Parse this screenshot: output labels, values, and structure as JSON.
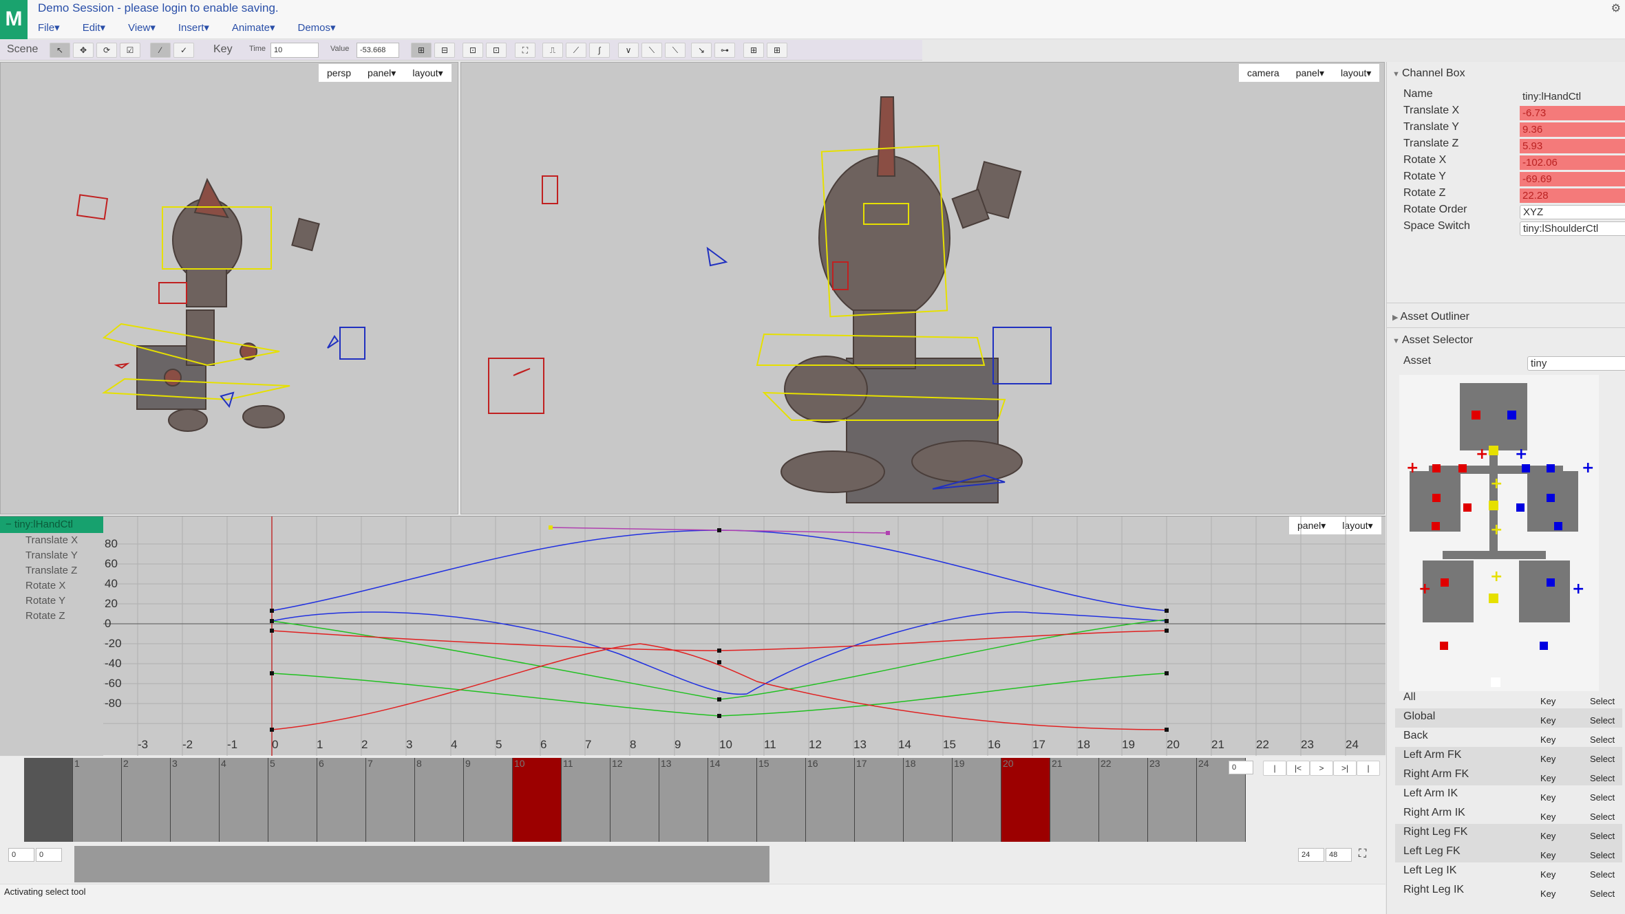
{
  "app": {
    "logo": "M",
    "session_message": "Demo Session - please login to enable saving.",
    "settings_icon": "gear-icon"
  },
  "menu": [
    "File▾",
    "Edit▾",
    "View▾",
    "Insert▾",
    "Animate▾",
    "Demos▾"
  ],
  "toolbar": {
    "scene_label": "Scene",
    "key_label": "Key",
    "time_label": "Time",
    "time_value": "10",
    "value_label": "Value",
    "value_value": "-53.668"
  },
  "viewport_left": {
    "camera": "persp",
    "panel": "panel▾",
    "layout": "layout▾"
  },
  "viewport_right": {
    "camera": "camera",
    "panel": "panel▾",
    "layout": "layout▾"
  },
  "graph_editor": {
    "selected_node": "− tiny:lHandCtl",
    "attributes": [
      "Translate X",
      "Translate Y",
      "Translate Z",
      "Rotate X",
      "Rotate Y",
      "Rotate Z"
    ],
    "panel": "panel▾",
    "layout": "layout▾",
    "y_ticks": [
      "80",
      "60",
      "40",
      "20",
      "0",
      "-20",
      "-40",
      "-60",
      "-80"
    ],
    "x_ticks": [
      "-3",
      "-2",
      "-1",
      "0",
      "1",
      "2",
      "3",
      "4",
      "5",
      "6",
      "7",
      "8",
      "9",
      "10",
      "11",
      "12",
      "13",
      "14",
      "15",
      "16",
      "17",
      "18",
      "19",
      "20",
      "21",
      "22",
      "23",
      "24"
    ]
  },
  "timeline": {
    "frames": [
      "",
      "1",
      "2",
      "3",
      "4",
      "5",
      "6",
      "7",
      "8",
      "9",
      "10",
      "11",
      "12",
      "13",
      "14",
      "15",
      "16",
      "17",
      "18",
      "19",
      "20",
      "21",
      "22",
      "23",
      "24"
    ],
    "key_frames": [
      10,
      20
    ],
    "current_frame_value": "0",
    "buttons": [
      "|",
      "|<",
      ">",
      ">|",
      "|"
    ]
  },
  "range": {
    "start_a": "0",
    "start_b": "0",
    "end_a": "24",
    "end_b": "48",
    "icon": "film-icon"
  },
  "status": "Activating select tool",
  "channel_box": {
    "title": "Channel Box",
    "name_label": "Name",
    "name_value": "tiny:lHandCtl",
    "channels": [
      {
        "label": "Translate X",
        "value": "-6.73"
      },
      {
        "label": "Translate Y",
        "value": "9.36"
      },
      {
        "label": "Translate Z",
        "value": "5.93"
      },
      {
        "label": "Rotate X",
        "value": "-102.06"
      },
      {
        "label": "Rotate Y",
        "value": "-69.69"
      },
      {
        "label": "Rotate Z",
        "value": "22.28"
      }
    ],
    "rotate_order_label": "Rotate Order",
    "rotate_order_value": "XYZ",
    "space_switch_label": "Space Switch",
    "space_switch_value": "tiny:lShoulderCtl"
  },
  "asset_outliner": {
    "title": "Asset Outliner"
  },
  "asset_selector": {
    "title": "Asset Selector",
    "asset_label": "Asset",
    "asset_value": "tiny",
    "groups": [
      {
        "label": "All",
        "key": "Key",
        "select": "Select"
      },
      {
        "label": "Global",
        "key": "Key",
        "select": "Select"
      },
      {
        "label": "Back",
        "key": "Key",
        "select": "Select"
      },
      {
        "label": "Left Arm FK",
        "key": "Key",
        "select": "Select"
      },
      {
        "label": "Right Arm FK",
        "key": "Key",
        "select": "Select"
      },
      {
        "label": "Left Arm IK",
        "key": "Key",
        "select": "Select"
      },
      {
        "label": "Right Arm IK",
        "key": "Key",
        "select": "Select"
      },
      {
        "label": "Right Leg FK",
        "key": "Key",
        "select": "Select"
      },
      {
        "label": "Left Leg FK",
        "key": "Key",
        "select": "Select"
      },
      {
        "label": "Left Leg IK",
        "key": "Key",
        "select": "Select"
      },
      {
        "label": "Right Leg IK",
        "key": "Key",
        "select": "Select"
      }
    ]
  },
  "colors": {
    "brand": "#1aa36e",
    "key_frame": "#9c0000",
    "channel_keyed": "#f47a7a",
    "curve_x": "#e02020",
    "curve_y": "#20c020",
    "curve_z": "#2030e0"
  }
}
